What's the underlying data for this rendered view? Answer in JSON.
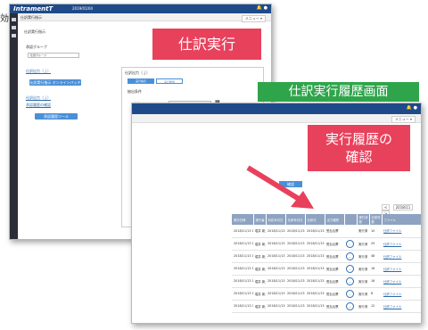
{
  "edge_char": "効",
  "shot1": {
    "logo": "IntramentT",
    "date": "2019/01/04",
    "breadcrumb": "仕訳実行指示",
    "menu_label": "メニュー ▾",
    "heading": "仕訳実行指示",
    "group_label": "承認グループ",
    "group_value": "仕訳グループ",
    "link1": "仕訳出力（ｊ）",
    "btn1": "仕訳実行指示 オンラインバッチ",
    "link2": "仕訳出力（ｊ）",
    "link3": "承認履歴の確認",
    "btn2": "承認履歴ツール",
    "panel": {
      "title": "仕訳出力（ｊ）",
      "tab_active": "実行指示",
      "tab_inactive": "実行履歴",
      "section": "抽出条件",
      "fields": [
        {
          "label": "y対応",
          "value": "2019/01/04"
        },
        {
          "label": "y仕訳年月日",
          "value": "2019/01/04"
        },
        {
          "label": "y日付",
          "value": "2019/01/04"
        }
      ],
      "opt1": "伝票日付を指定",
      "opt2": "月 上旬指定",
      "type_label": "出力種別",
      "all_label": "全て",
      "items": [
        "受払伝票（受払伝票（伝票訂正、不足）",
        "受払伝票（受払伝票（伝票訂正、不足）",
        "受払伝票（伝票訂正_不足）伝票（伝票訂正）",
        "受払伝票（伝票訂正_不足）伝票（伝票訂正）",
        "受払伝票（伝票訂正_不足）",
        "受払伝票（伝票訂正）"
      ],
      "run_button": "実行"
    }
  },
  "callout1": "仕訳実行",
  "banner": "仕訳実行履歴画面",
  "shot2": {
    "menu_label": "メニュー ▾",
    "confirm_button": "確認",
    "pager": [
      "<",
      "2018/11",
      ">"
    ],
    "headers": [
      "実行日時",
      "実行者",
      "対応年月日",
      "仕訳年月日",
      "仕訳日",
      "出力種別",
      "",
      "実行状態",
      "仕訳件数",
      "ファイル"
    ],
    "rows": [
      [
        "2018/11/13 13:46",
        "堀井 新太",
        "2018/11/13",
        "2018/11/13",
        "2018/11/13",
        "受払伝票",
        "",
        "実行済",
        "10",
        "仕訳ファイル"
      ],
      [
        "2018/11/13 10:35",
        "堀井 新太",
        "2018/11/13",
        "2018/11/13",
        "2018/11/13",
        "受払伝票",
        "…",
        "実行済",
        "29",
        "仕訳ファイル"
      ],
      [
        "2018/11/13 11:00",
        "堀井 新太",
        "2018/11/13",
        "2018/11/13",
        "2018/11/13",
        "受払伝票",
        "…",
        "実行済",
        "48",
        "仕訳ファイル"
      ],
      [
        "2018/11/13 10:20",
        "堀井 新太",
        "2018/11/13",
        "2018/11/13",
        "2018/11/13",
        "受払伝票",
        "…",
        "実行済",
        "16",
        "仕訳ファイル"
      ],
      [
        "2018/11/13 10:20",
        "堀井 新太",
        "2018/11/13",
        "2018/11/13",
        "2018/11/13",
        "受払伝票",
        "…",
        "実行済",
        "16",
        "仕訳ファイル"
      ],
      [
        "2018/11/13 10:05",
        "堀井 新太",
        "2018/11/13",
        "2018/11/13",
        "2018/11/13",
        "受払伝票",
        "…",
        "実行済",
        "8",
        "仕訳ファイル"
      ],
      [
        "2018/11/13 09:50",
        "堀井 新太",
        "2018/11/13",
        "2018/11/13",
        "2018/11/13",
        "受払伝票",
        "…",
        "実行済",
        "12",
        "仕訳ファイル"
      ]
    ]
  },
  "callout2_line1": "実行履歴の",
  "callout2_line2": "確認",
  "colors": {
    "header_blue": "#1f4a8a",
    "callout_pink": "#e8415c",
    "banner_green": "#2fa54b",
    "table_header": "#8ea3c2"
  }
}
